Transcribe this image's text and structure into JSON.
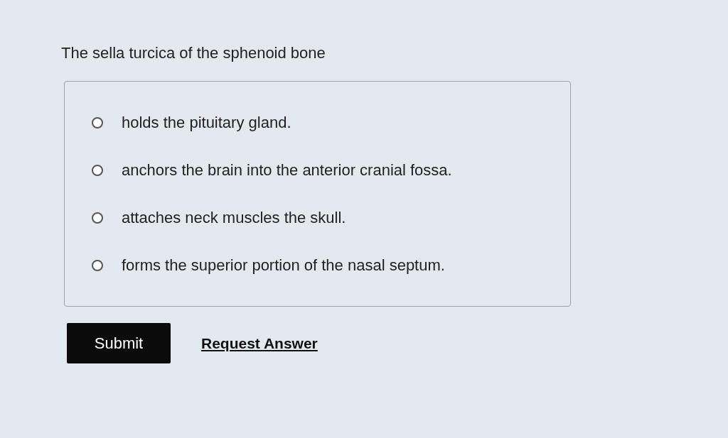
{
  "question": "The sella turcica of the sphenoid bone",
  "options": [
    {
      "label": "holds the pituitary gland.",
      "selected": false
    },
    {
      "label": "anchors the brain into the anterior cranial fossa.",
      "selected": false
    },
    {
      "label": "attaches neck muscles the skull.",
      "selected": false
    },
    {
      "label": "forms the superior portion of the nasal septum.",
      "selected": false
    }
  ],
  "submit": "Submit",
  "request_answer": "Request Answer"
}
